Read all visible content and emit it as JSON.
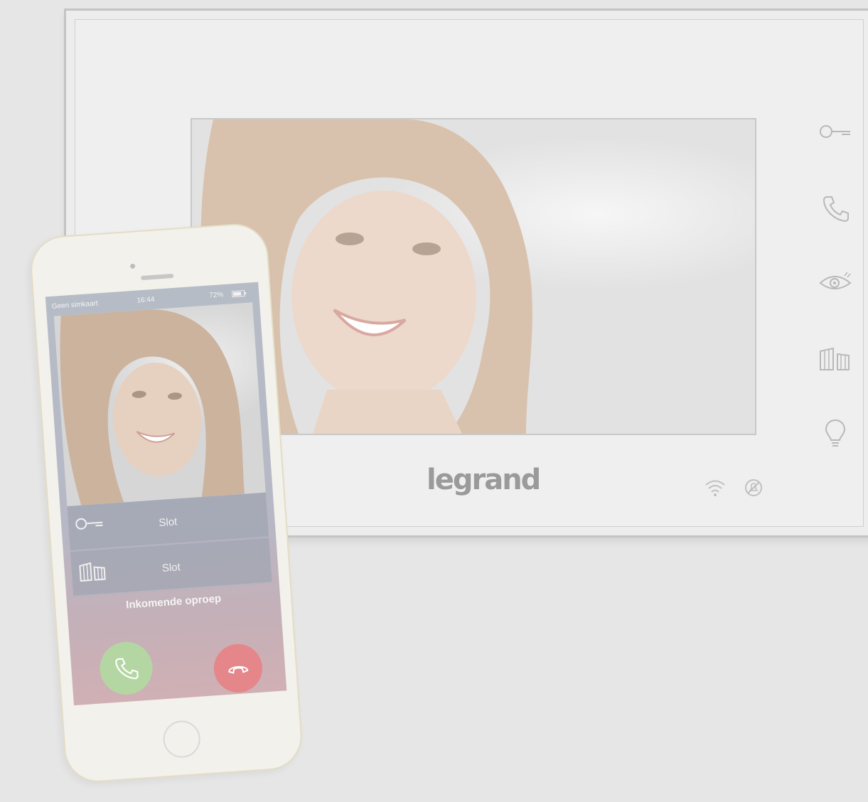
{
  "monitor": {
    "brand": "legrand",
    "side_buttons": [
      {
        "icon": "key-icon"
      },
      {
        "icon": "phone-icon"
      },
      {
        "icon": "eye-icon"
      },
      {
        "icon": "gate-icon"
      },
      {
        "icon": "bulb-icon"
      }
    ],
    "status_icons": [
      "wifi-icon",
      "do-not-disturb-icon"
    ]
  },
  "phone": {
    "status_bar": {
      "carrier": "Geen simkaart",
      "time": "16:44",
      "battery": "72%"
    },
    "actions": [
      {
        "icon": "key-icon",
        "label": "Slot"
      },
      {
        "icon": "gate-icon",
        "label": "Slot"
      }
    ],
    "incoming_label": "Inkomende oproep",
    "accept_icon": "phone-accept-icon",
    "reject_icon": "phone-hangup-icon"
  },
  "colors": {
    "accept": "#b4d6a2",
    "reject": "#e4868a",
    "logo": "#9a9a9a"
  }
}
